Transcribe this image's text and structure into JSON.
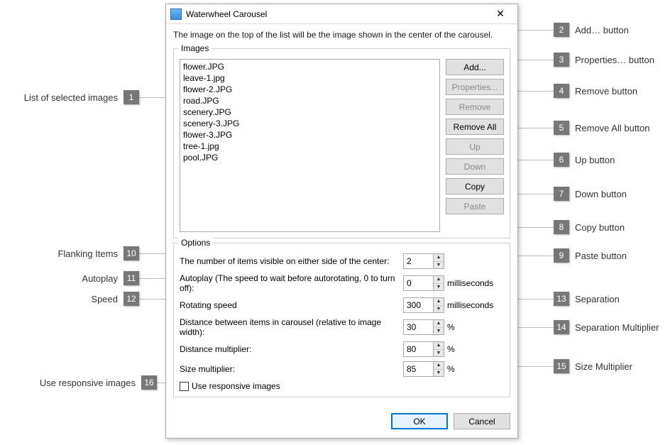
{
  "dialog": {
    "title": "Waterwheel Carousel",
    "close": "✕",
    "hint": "The image on the top of the list will be the image shown in the center of the carousel."
  },
  "images_group": {
    "legend": "Images",
    "items": [
      "flower.JPG",
      "leave-1.jpg",
      "flower-2.JPG",
      "road.JPG",
      "scenery.JPG",
      "scenery-3.JPG",
      "flower-3.JPG",
      "tree-1.jpg",
      "pool.JPG"
    ],
    "buttons": {
      "add": "Add...",
      "properties": "Properties...",
      "remove": "Remove",
      "remove_all": "Remove All",
      "up": "Up",
      "down": "Down",
      "copy": "Copy",
      "paste": "Paste"
    }
  },
  "options_group": {
    "legend": "Options",
    "flanking_label": "The number of items visible on either side of the center:",
    "flanking_value": "2",
    "autoplay_label": "Autoplay (The speed to wait before autorotating, 0 to turn off):",
    "autoplay_value": "0",
    "autoplay_unit": "milliseconds",
    "speed_label": "Rotating speed",
    "speed_value": "300",
    "speed_unit": "milliseconds",
    "separation_label": "Distance between items in carousel (relative to image width):",
    "separation_value": "30",
    "separation_unit": "%",
    "distmul_label": "Distance multiplier:",
    "distmul_value": "80",
    "distmul_unit": "%",
    "sizemul_label": "Size multiplier:",
    "sizemul_value": "85",
    "sizemul_unit": "%",
    "responsive_label": "Use responsive images"
  },
  "dialog_buttons": {
    "ok": "OK",
    "cancel": "Cancel"
  },
  "callouts": {
    "c1": {
      "n": "1",
      "t": "List of selected images"
    },
    "c2": {
      "n": "2",
      "t": "Add… button"
    },
    "c3": {
      "n": "3",
      "t": "Properties… button"
    },
    "c4": {
      "n": "4",
      "t": "Remove button"
    },
    "c5": {
      "n": "5",
      "t": "Remove All button"
    },
    "c6": {
      "n": "6",
      "t": "Up button"
    },
    "c7": {
      "n": "7",
      "t": "Down button"
    },
    "c8": {
      "n": "8",
      "t": "Copy button"
    },
    "c9": {
      "n": "9",
      "t": "Paste button"
    },
    "c10": {
      "n": "10",
      "t": "Flanking Items"
    },
    "c11": {
      "n": "11",
      "t": "Autoplay"
    },
    "c12": {
      "n": "12",
      "t": "Speed"
    },
    "c13": {
      "n": "13",
      "t": "Separation"
    },
    "c14": {
      "n": "14",
      "t": "Separation Multiplier"
    },
    "c15": {
      "n": "15",
      "t": "Size Multiplier"
    },
    "c16": {
      "n": "16",
      "t": "Use responsive images"
    }
  }
}
